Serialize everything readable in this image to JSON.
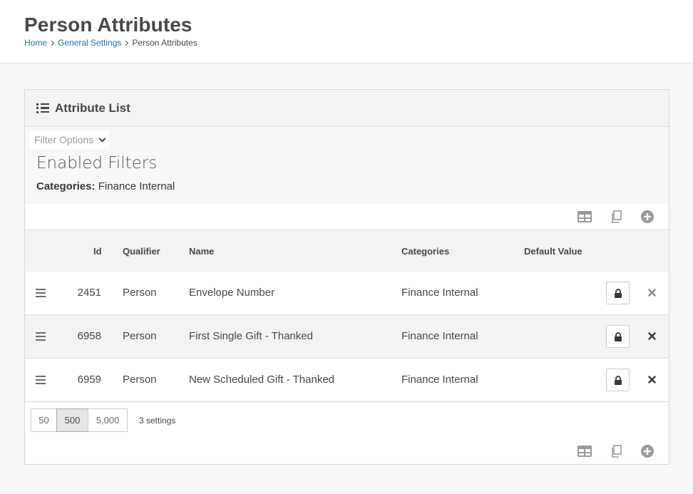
{
  "header": {
    "title": "Person Attributes",
    "breadcrumb": [
      {
        "label": "Home"
      },
      {
        "label": "General Settings"
      },
      {
        "label": "Person Attributes"
      }
    ]
  },
  "panel": {
    "title": "Attribute List",
    "icon": "list-icon"
  },
  "filters": {
    "toggle_label": "Filter Options",
    "enabled_title": "Enabled Filters",
    "items": [
      {
        "label": "Categories:",
        "value": "Finance Internal"
      }
    ]
  },
  "grid": {
    "columns": [
      "Id",
      "Qualifier",
      "Name",
      "Categories",
      "Default Value"
    ],
    "rows": [
      {
        "id": "2451",
        "qualifier": "Person",
        "name": "Envelope Number",
        "categories": "Finance Internal",
        "default_value": "",
        "delete_color": "#8a8a8a"
      },
      {
        "id": "6958",
        "qualifier": "Person",
        "name": "First Single Gift - Thanked",
        "categories": "Finance Internal",
        "default_value": "",
        "delete_color": "#343a40"
      },
      {
        "id": "6959",
        "qualifier": "Person",
        "name": "New Scheduled Gift - Thanked",
        "categories": "Finance Internal",
        "default_value": "",
        "delete_color": "#343a40"
      }
    ],
    "actions": [
      "excel-export-icon",
      "merge-template-icon",
      "add-icon"
    ]
  },
  "pager": {
    "sizes": [
      "50",
      "500",
      "5,000"
    ],
    "active_size": "500",
    "item_count": "3 settings"
  },
  "colors": {
    "link": "#2670a9",
    "text": "#484848",
    "icon": "#9a9a9a"
  }
}
